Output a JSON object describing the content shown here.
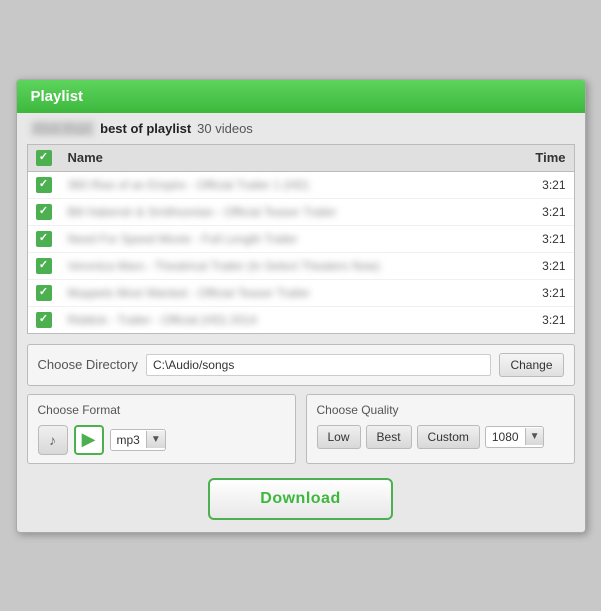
{
  "titleBar": {
    "label": "Playlist"
  },
  "playlistInfo": {
    "owner": "Rick Ruyt",
    "name": "best of playlist",
    "count": "30 videos"
  },
  "tableHeader": {
    "nameCol": "Name",
    "timeCol": "Time"
  },
  "rows": [
    {
      "name": "360 Rise of an Empire - Official Trailer 1 (HD)",
      "time": "3:21",
      "checked": true
    },
    {
      "name": "Bill Haberstr & Smithsonian - Official Teaser Trailer",
      "time": "3:21",
      "checked": true
    },
    {
      "name": "Need For Speed Movie - Full Length Trailer",
      "time": "3:21",
      "checked": true
    },
    {
      "name": "Veronica Mars - Theatrical Trailer (In Select Theaters Now)",
      "time": "3:21",
      "checked": true
    },
    {
      "name": "Muppets Most Wanted - Official Teaser Trailer",
      "time": "3:21",
      "checked": true
    },
    {
      "name": "Riddick - Trailer - Official (HD) 2014",
      "time": "3:21",
      "checked": true
    }
  ],
  "directorySection": {
    "label": "Choose Directory",
    "value": "C:\\Audio/songs",
    "changeBtn": "Change"
  },
  "formatSection": {
    "label": "Choose Format",
    "audioIconTitle": "audio",
    "playIconTitle": "play",
    "formatValue": "mp3",
    "formatArrow": "▼"
  },
  "qualitySection": {
    "label": "Choose Quality",
    "lowBtn": "Low",
    "bestBtn": "Best",
    "customBtn": "Custom",
    "qualityValue": "1080",
    "qualityArrow": "▼"
  },
  "downloadBtn": "Download"
}
